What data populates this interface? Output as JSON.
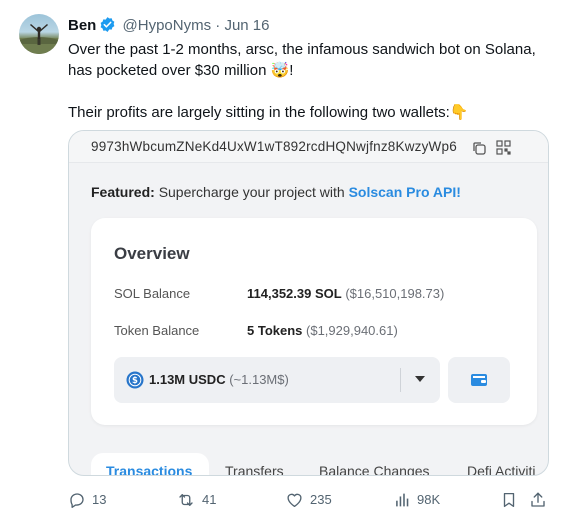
{
  "tweet": {
    "author_name": "Ben",
    "handle": "@HypoNyms",
    "separator": "·",
    "date": "Jun 16",
    "line1": "Over the past 1-2 months, arsc, the infamous sandwich bot on Solana,",
    "line2": "has pocketed over $30 million 🤯!",
    "line3": "Their profits are largely sitting in the following two wallets:👇"
  },
  "embed": {
    "address": "9973hWbcumZNeKd4UxW1wT892rcdHQNwjfnz8KwzyWp6",
    "featured_label": "Featured:",
    "featured_text": "Supercharge your project with",
    "featured_link": "Solscan Pro API!",
    "overview_title": "Overview",
    "sol_balance_label": "SOL Balance",
    "sol_balance_value": "114,352.39 SOL",
    "sol_balance_usd": "($16,510,198.73)",
    "token_balance_label": "Token Balance",
    "token_balance_value": "5 Tokens",
    "token_balance_usd": "($1,929,940.61)",
    "token_selected": "1.13M USDC",
    "token_selected_sub": "(~1.13M$)",
    "tabs": [
      "Transactions",
      "Transfers",
      "Balance Changes",
      "Defi Activiti"
    ]
  },
  "actions": {
    "replies": "13",
    "reposts": "41",
    "likes": "235",
    "views": "98K"
  },
  "icons": [
    "verified-badge-icon",
    "copy-icon",
    "qr-icon",
    "usdc-icon",
    "chevron-down-icon",
    "wallet-icon",
    "reply-icon",
    "repost-icon",
    "like-icon",
    "views-icon",
    "bookmark-icon",
    "share-icon"
  ],
  "colors": {
    "verified": "#1d9bf0",
    "link": "#2a8be0",
    "muted_text": "#536471",
    "usdc": "#2775ca"
  }
}
